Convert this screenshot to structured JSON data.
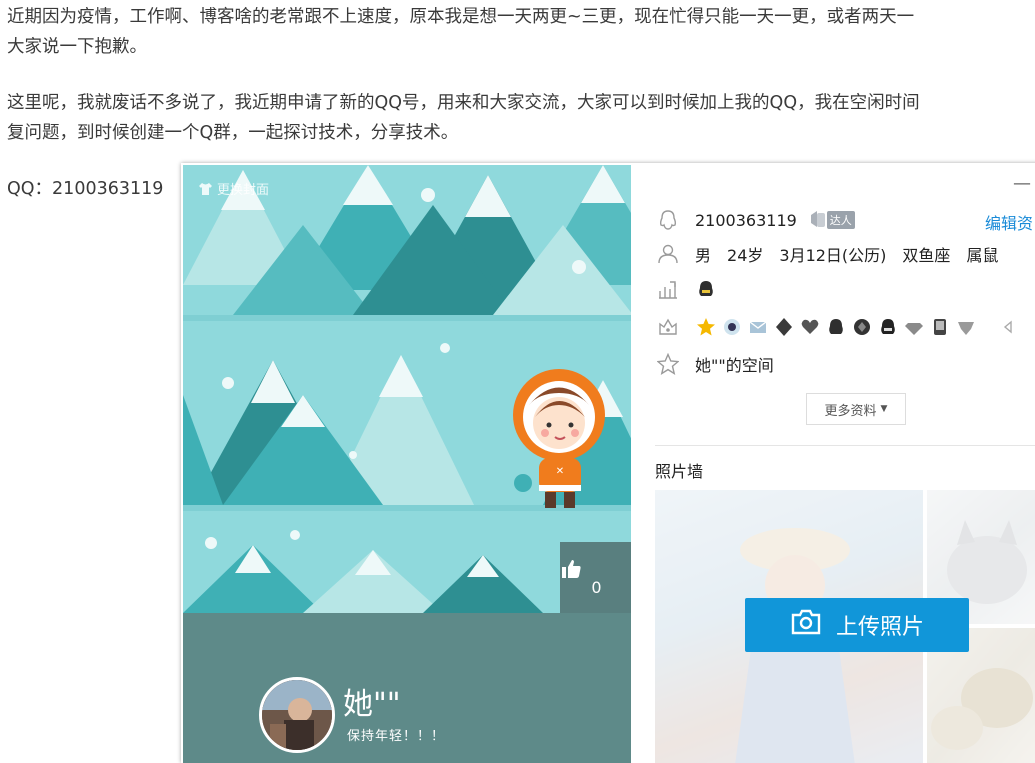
{
  "article": {
    "para1_line1": "近期因为疫情，工作啊、博客啥的老常跟不上速度，原本我是想一天两更~三更，现在忙得只能一天一更，或者两天一",
    "para1_line2": "大家说一下抱歉。",
    "para2_line1": "这里呢，我就废话不多说了，我近期申请了新的QQ号，用来和大家交流，大家可以到时候加上我的QQ，我在空闲时间",
    "para2_line2": "复问题，到时候创建一个Q群，一起探讨技术，分享技术。",
    "qq_line": "QQ：2100363119"
  },
  "card": {
    "change_cover_label": "更换封面",
    "like_count": "0",
    "nickname": "她\"\"",
    "motto": "保持年轻！！！",
    "minimize_label": "—",
    "qq_number": "2100363119",
    "talent_badge": "达人",
    "edit_label": "编辑资",
    "gender": "男",
    "age": "24岁",
    "birthday": "3月12日(公历)",
    "zodiac": "双鱼座",
    "chinese_zodiac": "属鼠",
    "space_name": "她\"\"的空间",
    "more_info_label": "更多资料",
    "photo_wall_title": "照片墙",
    "upload_label": "上传照片"
  },
  "colors": {
    "upload_button": "#1196d9",
    "edit_link": "#1a8bd8",
    "cover_footer": "#5e8a89",
    "cover_sky": "#8fd9dc"
  }
}
